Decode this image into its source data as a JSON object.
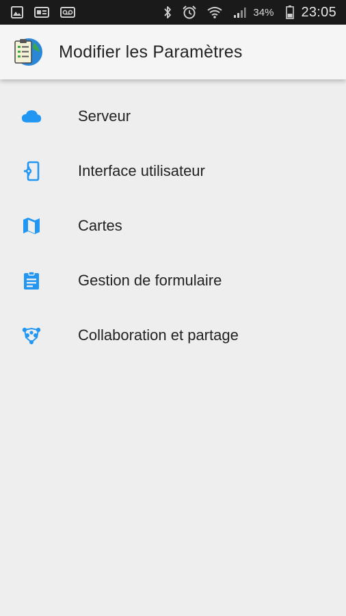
{
  "status_bar": {
    "left_icons": [
      "gallery-icon",
      "sim-card-icon",
      "voicemail-icon"
    ],
    "right_icons": [
      "bluetooth-icon",
      "alarm-icon",
      "wifi-icon",
      "signal-icon",
      "battery-icon"
    ],
    "battery": "34%",
    "time": "23:05"
  },
  "app_bar": {
    "title": "Modifier les Paramètres",
    "logo_icon": "app-logo-icon"
  },
  "settings": {
    "accent_color": "#2196f3",
    "items": [
      {
        "label": "Serveur",
        "icon": "cloud-icon"
      },
      {
        "label": "Interface utilisateur",
        "icon": "settings-cell-icon"
      },
      {
        "label": "Cartes",
        "icon": "map-icon"
      },
      {
        "label": "Gestion de formulaire",
        "icon": "assignment-icon"
      },
      {
        "label": "Collaboration et partage",
        "icon": "network-icon"
      }
    ]
  }
}
